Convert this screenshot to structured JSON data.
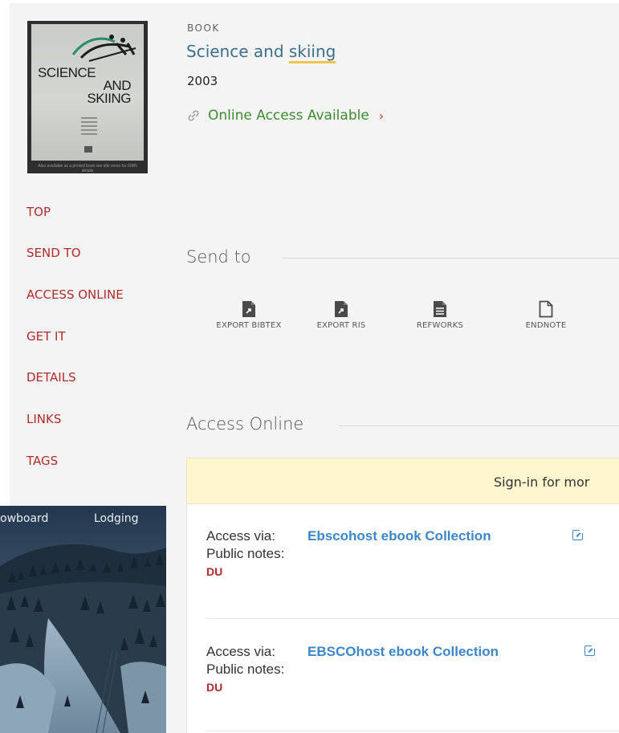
{
  "record": {
    "type_label": "BOOK",
    "title_part1": "Science and ",
    "title_highlight": "skiing",
    "year": "2003",
    "online_access": "Online Access Available",
    "chevron": "›"
  },
  "cover": {
    "line1": "SCIENCE",
    "line2": "AND",
    "line3": "SKIING",
    "footer": "Also available as a printed book see title verso for ISBN details"
  },
  "nav": {
    "items": [
      "TOP",
      "SEND TO",
      "ACCESS ONLINE",
      "GET IT",
      "DETAILS",
      "LINKS",
      "TAGS"
    ]
  },
  "send_to": {
    "title": "Send to",
    "actions": [
      {
        "label": "EXPORT BIBTEX",
        "icon": "export-bibtex-icon"
      },
      {
        "label": "EXPORT RIS",
        "icon": "export-ris-icon"
      },
      {
        "label": "REFWORKS",
        "icon": "refworks-icon"
      },
      {
        "label": "ENDNOTE",
        "icon": "endnote-icon"
      }
    ]
  },
  "access_online": {
    "title": "Access Online",
    "signin_text": "Sign-in for mor",
    "entries": [
      {
        "via_label": "Access via:",
        "database": "Ebscohost ebook Collection",
        "notes_label": "Public notes:",
        "note": "DU"
      },
      {
        "via_label": "Access via:",
        "database": "EBSCOhost ebook Collection",
        "notes_label": "Public notes:",
        "note": "DU"
      }
    ]
  },
  "photo_overlay": {
    "nav_item_1": "owboard",
    "nav_item_2": "Lodging"
  },
  "colors": {
    "link_teal": "#3c6f8c",
    "nav_red": "#b22a2a",
    "online_green": "#3e8a2f",
    "database_blue": "#3c86c9",
    "banner_yellow": "#fdf6cf",
    "highlight_yellow": "#f3c64b"
  }
}
